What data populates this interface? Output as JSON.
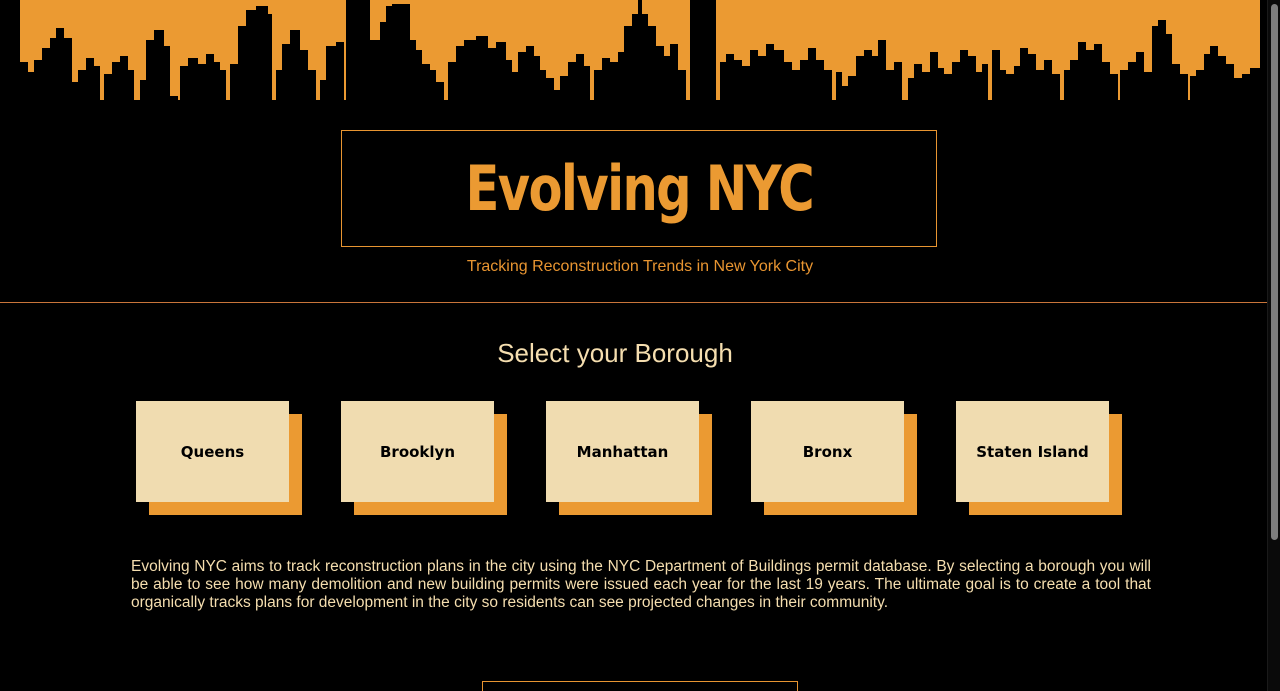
{
  "header": {
    "title": "Evolving NYC",
    "subtitle": "Tracking Reconstruction Trends in New York City",
    "skyline_color": "#eb9a32"
  },
  "borough_section": {
    "heading": "Select your Borough",
    "boroughs": [
      {
        "label": "Queens"
      },
      {
        "label": "Brooklyn"
      },
      {
        "label": "Manhattan"
      },
      {
        "label": "Bronx"
      },
      {
        "label": "Staten Island"
      }
    ]
  },
  "description": "Evolving NYC aims to track reconstruction plans in the city using the NYC Department of Buildings permit database. By selecting a borough you will be able to see how many demolition and new building permits were issued each year for the last 19 years. The ultimate goal is to create a tool that organically tracks plans for development in the city so residents can see projected changes in their community.",
  "colors": {
    "accent": "#eb9a32",
    "card": "#f0dcb0",
    "text_light": "#f5deaf",
    "background": "#000000"
  }
}
